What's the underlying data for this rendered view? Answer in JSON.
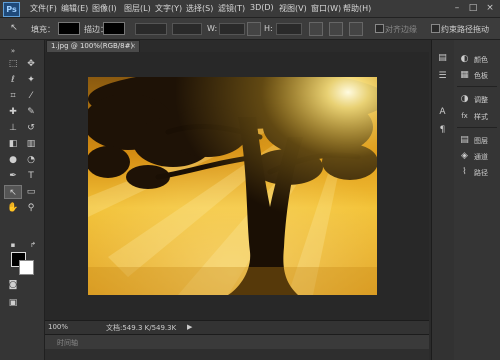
{
  "app": {
    "logo": "Ps"
  },
  "menu": [
    "文件(F)",
    "编辑(E)",
    "图像(I)",
    "图层(L)",
    "文字(Y)",
    "选择(S)",
    "滤镜(T)",
    "3D(D)",
    "视图(V)",
    "窗口(W)",
    "帮助(H)"
  ],
  "window_controls": [
    "–",
    "□",
    "×"
  ],
  "options": {
    "fill_label": "填充：",
    "stroke_label": "描边：",
    "w_label": "W:",
    "h_label": "H:",
    "align_edges_label": "对齐边缘",
    "constrain_path_label": "约束路径拖动"
  },
  "document": {
    "tab_title": "1.jpg @ 100%(RGB/8#)",
    "tab_close": "×"
  },
  "status": {
    "zoom": "100%",
    "doc_size": "文档:549.3 K/549.3K",
    "arrow": "▶"
  },
  "timeline": {
    "label": "时间轴"
  },
  "panels": [
    {
      "icon": "palette-icon",
      "label": "颜色",
      "glyph": "◐"
    },
    {
      "icon": "swatches-icon",
      "label": "色板",
      "glyph": "▦"
    },
    {
      "icon": "adjustments-icon",
      "label": "调整",
      "glyph": "◑"
    },
    {
      "icon": "styles-icon",
      "label": "样式",
      "glyph": "fx"
    },
    {
      "icon": "layers-icon",
      "label": "图层",
      "glyph": "▤"
    },
    {
      "icon": "channels-icon",
      "label": "通道",
      "glyph": "◈"
    },
    {
      "icon": "paths-icon",
      "label": "路径",
      "glyph": "⌇"
    }
  ],
  "colors": {
    "foreground": "#000000",
    "background": "#ffffff"
  }
}
